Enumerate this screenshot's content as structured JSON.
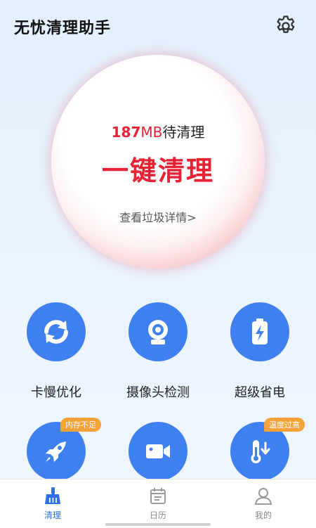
{
  "app": {
    "title": "无忧清理助手"
  },
  "header": {
    "settings_icon": "gear-icon"
  },
  "cleaner": {
    "junk_amount": "187",
    "junk_unit": "MB",
    "junk_suffix": "待清理",
    "action_label": "一键清理",
    "details_link": "查看垃圾详情>"
  },
  "features": [
    {
      "label": "卡慢优化",
      "icon": "refresh-icon"
    },
    {
      "label": "摄像头检测",
      "icon": "webcam-icon"
    },
    {
      "label": "超级省电",
      "icon": "battery-charge-icon"
    },
    {
      "label": "",
      "icon": "rocket-icon",
      "badge": "内存不足"
    },
    {
      "label": "",
      "icon": "video-camera-icon"
    },
    {
      "label": "",
      "icon": "thermometer-icon",
      "badge": "温度过高"
    }
  ],
  "tabs": [
    {
      "label": "清理",
      "icon": "broom-icon",
      "active": true
    },
    {
      "label": "日历",
      "icon": "calendar-icon",
      "active": false
    },
    {
      "label": "我的",
      "icon": "user-icon",
      "active": false
    }
  ],
  "colors": {
    "accent": "#3f80f1",
    "danger": "#e52335",
    "badge": "#f4a23a",
    "tab_active": "#2f6ee6"
  }
}
